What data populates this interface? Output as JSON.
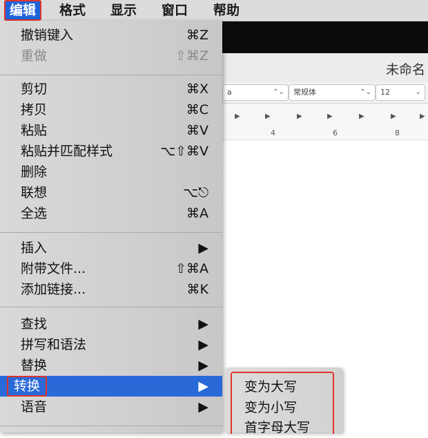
{
  "menubar": {
    "items": [
      "编辑",
      "格式",
      "显示",
      "窗口",
      "帮助"
    ]
  },
  "document": {
    "title": "未命名",
    "font_style": "常规体",
    "font_size": "12",
    "ruler_numbers": [
      "4",
      "6",
      "8"
    ]
  },
  "edit_menu": {
    "items": [
      {
        "label": "撤销键入",
        "key": "⌘Z"
      },
      {
        "label": "重做",
        "key": "⇧⌘Z",
        "disabled": true
      },
      {
        "label": "剪切",
        "key": "⌘X"
      },
      {
        "label": "拷贝",
        "key": "⌘C"
      },
      {
        "label": "粘贴",
        "key": "⌘V"
      },
      {
        "label": "粘贴并匹配样式",
        "key": "⌥⇧⌘V"
      },
      {
        "label": "删除",
        "key": ""
      },
      {
        "label": "联想",
        "key": "⌥⎋"
      },
      {
        "label": "全选",
        "key": "⌘A"
      },
      {
        "label": "插入",
        "key": "▶"
      },
      {
        "label": "附带文件...",
        "key": "⇧⌘A"
      },
      {
        "label": "添加链接...",
        "key": "⌘K"
      },
      {
        "label": "查找",
        "key": "▶"
      },
      {
        "label": "拼写和语法",
        "key": "▶"
      },
      {
        "label": "替换",
        "key": "▶"
      },
      {
        "label": "转换",
        "key": "▶",
        "selected": true
      },
      {
        "label": "语音",
        "key": "▶"
      }
    ]
  },
  "transform_submenu": {
    "items": [
      "变为大写",
      "变为小写",
      "首字母大写"
    ]
  },
  "colors": {
    "accent": "#2a6ad8",
    "highlight_box": "#e0342b"
  }
}
